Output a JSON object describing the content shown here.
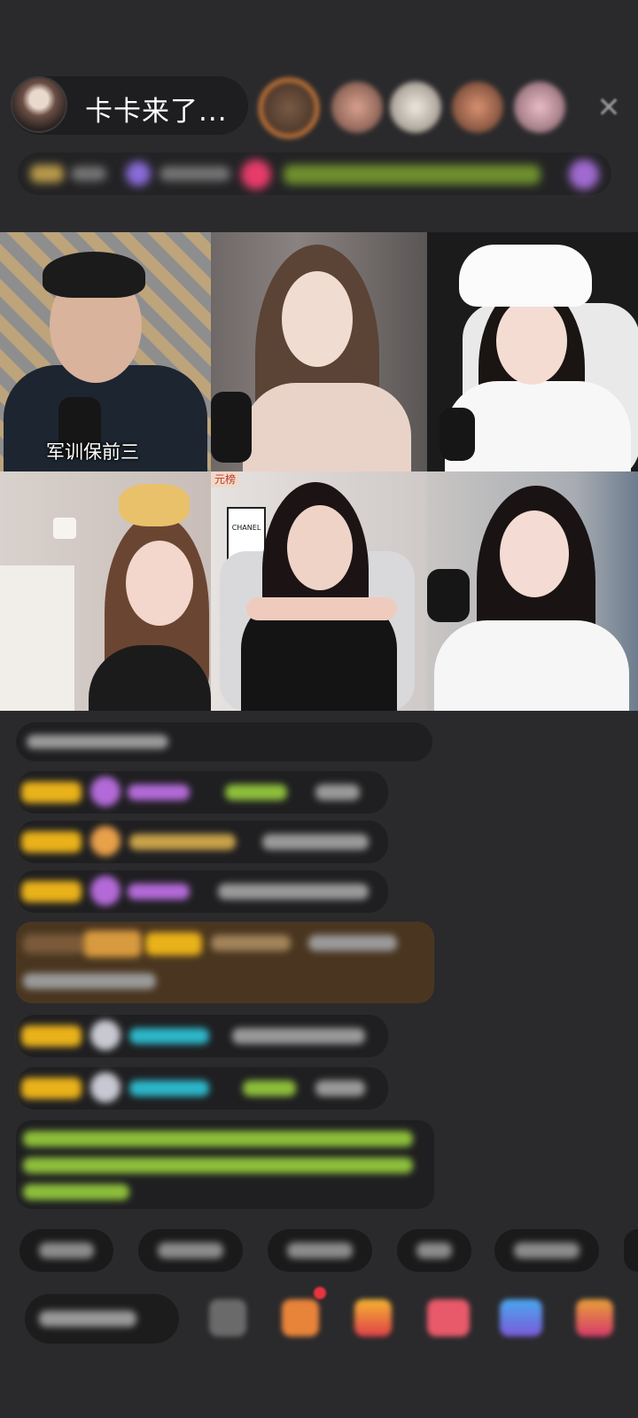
{
  "header": {
    "host_name": "卡卡来了...",
    "viewers": [
      {
        "color": "#e8863a"
      },
      {
        "color": "#c58b7a"
      },
      {
        "color": "#d9d2c8"
      },
      {
        "color": "#c07a55"
      },
      {
        "color": "#d6a3b2"
      }
    ],
    "close_icon": "close-icon"
  },
  "grid": {
    "tiles": [
      {
        "caption": "军训保前三"
      },
      {
        "caption": ""
      },
      {
        "caption": ""
      },
      {
        "caption": ""
      },
      {
        "caption": "",
        "badge": "元榜",
        "poster_text": "CHANEL"
      },
      {
        "caption": ""
      }
    ]
  },
  "colors": {
    "background": "#2a2a2c",
    "badge_yellow": "#e9b21a",
    "name_purple": "#b36ad8",
    "name_cyan": "#2cb7c9",
    "system_green": "#8dbf3b"
  }
}
